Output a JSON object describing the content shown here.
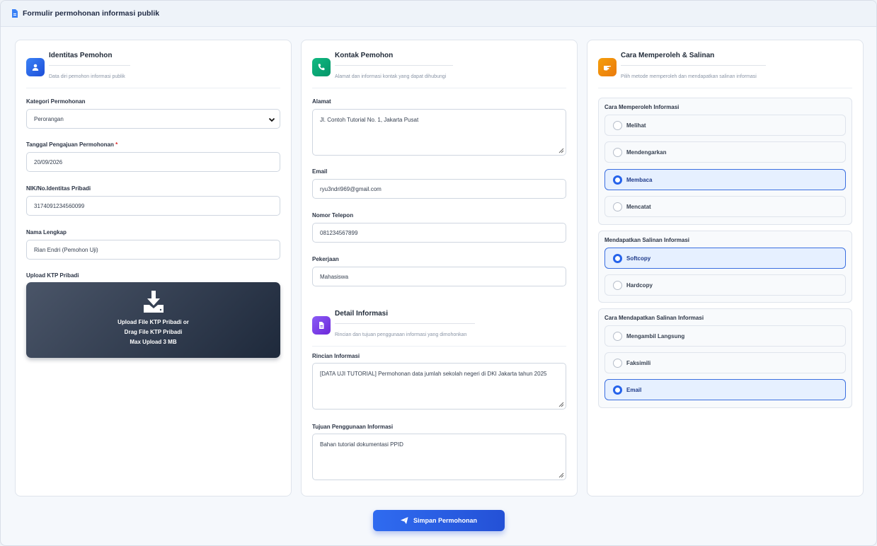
{
  "header": {
    "title": "Formulir permohonan informasi publik",
    "icon": "document-icon"
  },
  "identitas": {
    "title": "Identitas Pemohon",
    "subtitle": "Data diri pemohon informasi publik",
    "icon": "user-icon",
    "kategori": {
      "label": "Kategori Permohonan",
      "value": "Perorangan"
    },
    "tanggal": {
      "label": "Tanggal Pengajuan Permohonan",
      "required_mark": "*",
      "value": "20/09/2026"
    },
    "nik": {
      "label": "NIK/No.Identitas Pribadi",
      "value": "3174091234560099"
    },
    "nama": {
      "label": "Nama Lengkap",
      "value": "Rian Endri (Pemohon Uji)"
    },
    "upload": {
      "label": "Upload KTP Pribadi",
      "line1": "Upload File KTP Pribadi or",
      "line2": "Drag File KTP Pribadi",
      "line3": "Max Upload 3 MB",
      "icon": "download-icon"
    }
  },
  "kontak": {
    "title": "Kontak Pemohon",
    "subtitle": "Alamat dan informasi kontak yang dapat dihubungi",
    "icon": "phone-icon",
    "alamat": {
      "label": "Alamat",
      "value": "Jl. Contoh Tutorial No. 1, Jakarta Pusat"
    },
    "email": {
      "label": "Email",
      "value": "ryu3ndri969@gmail.com"
    },
    "telepon": {
      "label": "Nomor Telepon",
      "value": "081234567899"
    },
    "pekerjaan": {
      "label": "Pekerjaan",
      "value": "Mahasiswa"
    }
  },
  "detail": {
    "title": "Detail Informasi",
    "subtitle": "Rincian dan tujuan penggunaan informasi yang dimohonkan",
    "icon": "file-icon",
    "rincian": {
      "label": "Rincian Informasi",
      "value": "[DATA UJI TUTORIAL] Permohonan data jumlah sekolah negeri di DKI Jakarta tahun 2025"
    },
    "tujuan": {
      "label": "Tujuan Penggunaan Informasi",
      "value": "Bahan tutorial dokumentasi PPID"
    }
  },
  "cara": {
    "title": "Cara Memperoleh & Salinan",
    "subtitle": "Pilih metode memperoleh dan mendapatkan salinan informasi",
    "icon": "hand-pointing-icon",
    "memperoleh": {
      "title": "Cara Memperoleh Informasi",
      "options": [
        {
          "label": "Melihat",
          "selected": false
        },
        {
          "label": "Mendengarkan",
          "selected": false
        },
        {
          "label": "Membaca",
          "selected": true
        },
        {
          "label": "Mencatat",
          "selected": false
        }
      ]
    },
    "salinan": {
      "title": "Mendapatkan Salinan Informasi",
      "options": [
        {
          "label": "Softcopy",
          "selected": true
        },
        {
          "label": "Hardcopy",
          "selected": false
        }
      ]
    },
    "cara_salinan": {
      "title": "Cara Mendapatkan Salinan Informasi",
      "options": [
        {
          "label": "Mengambil Langsung",
          "selected": false
        },
        {
          "label": "Faksimili",
          "selected": false
        },
        {
          "label": "Email",
          "selected": true
        }
      ]
    }
  },
  "submit": {
    "label": "Simpan Permohonan",
    "icon": "send-icon"
  },
  "colors": {
    "primary": "#2563eb",
    "selected_bg": "#e6f0ff",
    "dark_upload": "#1e293b"
  }
}
